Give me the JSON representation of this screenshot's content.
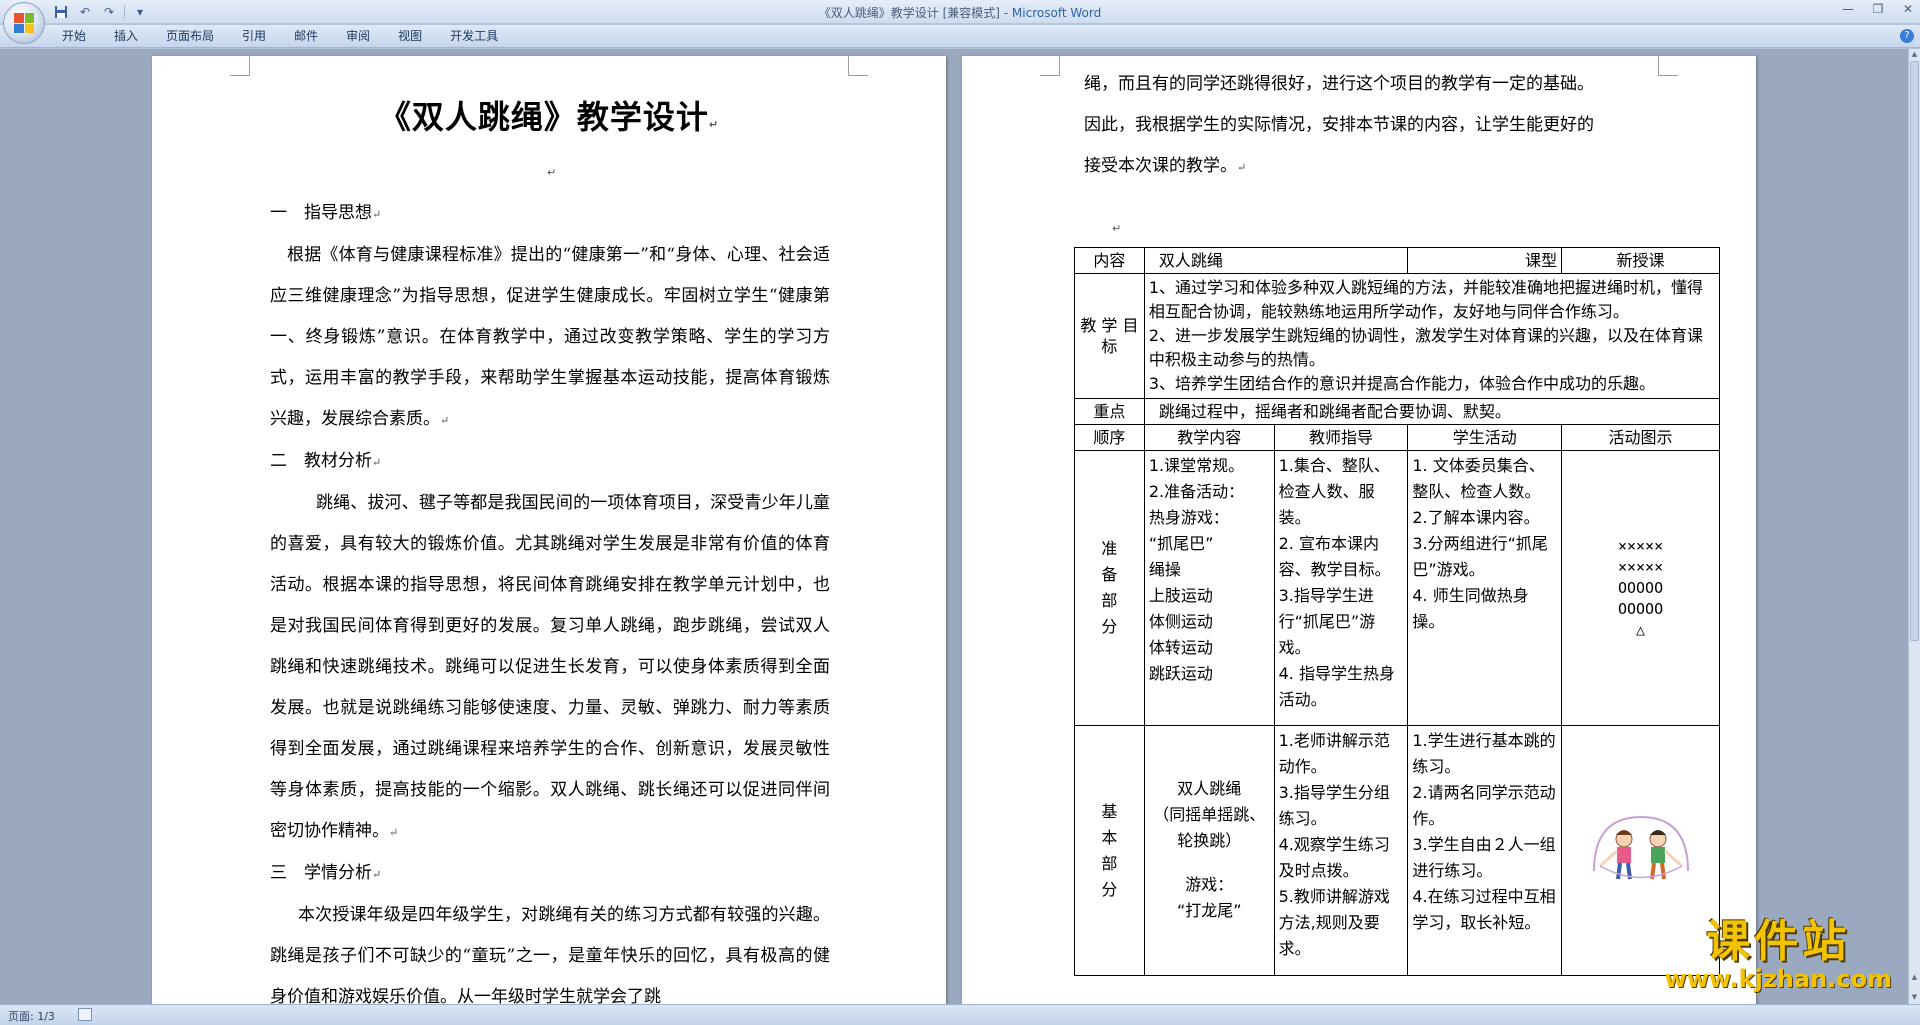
{
  "window": {
    "title_prefix": "《双人跳绳》教学设计 [兼容模式] - ",
    "title_app": "Microsoft Word",
    "controls": [
      "—",
      "❐",
      "✕"
    ]
  },
  "ribbon": {
    "tabs": [
      "开始",
      "插入",
      "页面布局",
      "引用",
      "邮件",
      "审阅",
      "视图",
      "开发工具"
    ],
    "help": "?"
  },
  "left_page": {
    "title": "《双人跳绳》教学设计",
    "sections": [
      {
        "heading": "一　指导思想",
        "body": "根据《体育与健康课程标准》提出的“健康第一”和“身体、心理、社会适应三维健康理念”为指导思想，促进学生健康成长。牢固树立学生“健康第一、终身锻炼”意识。在体育教学中，通过改变教学策略、学生的学习方式，运用丰富的教学手段，来帮助学生掌握基本运动技能，提高体育锻炼兴趣，发展综合素质。"
      },
      {
        "heading": "二　教材分析",
        "body": "跳绳、拔河、毽子等都是我国民间的一项体育项目，深受青少年儿童的喜爱，具有较大的锻炼价值。尤其跳绳对学生发展是非常有价值的体育活动。根据本课的指导思想，将民间体育跳绳安排在教学单元计划中，也是对我国民间体育得到更好的发展。复习单人跳绳，跑步跳绳，尝试双人跳绳和快速跳绳技术。跳绳可以促进生长发育，可以使身体素质得到全面发展。也就是说跳绳练习能够使速度、力量、灵敏、弹跳力、耐力等素质得到全面发展，通过跳绳课程来培养学生的合作、创新意识，发展灵敏性等身体素质，提高技能的一个缩影。双人跳绳、跳长绳还可以促进同伴间密切协作精神。"
      },
      {
        "heading": "三　学情分析",
        "body": "本次授课年级是四年级学生，对跳绳有关的练习方式都有较强的兴趣。跳绳是孩子们不可缺少的“童玩”之一，是童年快乐的回忆，具有极高的健身价值和游戏娱乐价值。从一年级时学生就学会了跳"
      }
    ]
  },
  "right_page": {
    "intro_lines": [
      "绳，而且有的同学还跳得很好，进行这个项目的教学有一定的基础。",
      "因此，我根据学生的实际情况，安排本节课的内容，让学生能更好的",
      "接受本次课的教学。"
    ],
    "table": {
      "content_label": "内容",
      "content_value": "双人跳绳",
      "type_label": "课型",
      "type_value": "新授课",
      "goals_label": "教 学 目标",
      "goals": [
        "1、通过学习和体验多种双人跳短绳的方法，并能较准确地把握进绳时机，懂得相互配合协调，能较熟练地运用所学动作，友好地与同伴合作练习。",
        "2、进一步发展学生跳短绳的协调性，激发学生对体育课的兴趣，以及在体育课中积极主动参与的热情。",
        "3、培养学生团结合作的意识并提高合作能力，体验合作中成功的乐趣。"
      ],
      "key_label": "重点",
      "key_value": "跳绳过程中，摇绳者和跳绳者配合要协调、默契。",
      "headers": [
        "顺序",
        "教学内容",
        "教师指导",
        "学生活动",
        "活动图示"
      ],
      "rows": [
        {
          "order": "准备部分",
          "content": [
            "1.课堂常规。",
            "2.准备活动：",
            "热身游戏：",
            "“抓尾巴”",
            "绳操",
            "上肢运动",
            "体侧运动",
            "体转运动",
            "跳跃运动"
          ],
          "teacher": [
            "1.集合、整队、检查人数、服装。",
            "2. 宣布本课内容、教学目标。",
            "3.指导学生进行“抓尾巴”游戏。",
            "4. 指导学生热身活动。"
          ],
          "student": [
            "1. 文体委员集合、整队、检查人数。",
            "2.了解本课内容。",
            "3.分两组进行“抓尾巴”游戏。",
            "4. 师生同做热身操。"
          ],
          "diagram": [
            "×××××",
            "×××××",
            "OOOOO",
            "OOOOO",
            "△"
          ]
        },
        {
          "order": "基本部分",
          "content": [
            "双人跳绳",
            "（同摇单摇跳、轮换跳）",
            "游戏：",
            "“打龙尾”"
          ],
          "teacher": [
            "1.老师讲解示范动作。",
            "3.指导学生分组练习。",
            "4.观察学生练习及时点拨。",
            "5.教师讲解游戏方法,规则及要求。"
          ],
          "student": [
            "1.学生进行基本跳的练习。",
            "2.请两名同学示范动作。",
            "3.学生自由２人一组进行练习。",
            "4.在练习过程中互相学习，取长补短。"
          ],
          "diagram": []
        }
      ]
    }
  },
  "watermark": {
    "main": "课件站",
    "url": "www.kjzhan.com"
  },
  "status": {
    "page_info": "页面: 1/3"
  },
  "colors": {
    "title_app": "#2e63a8",
    "workspace": "#9aa9c0",
    "watermark": "#f3c300"
  }
}
